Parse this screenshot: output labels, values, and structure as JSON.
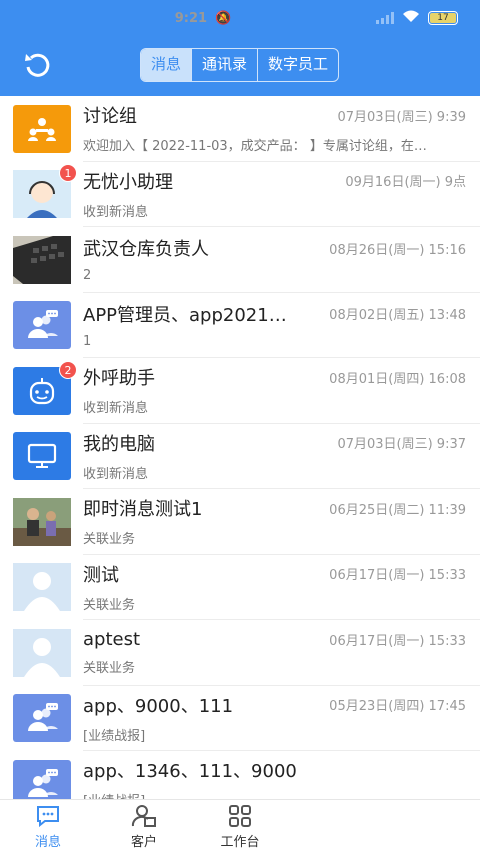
{
  "status": {
    "time": "9:21",
    "battery": "17"
  },
  "header": {
    "tabs": [
      {
        "label": "消息",
        "active": true
      },
      {
        "label": "通讯录",
        "active": false
      },
      {
        "label": "数字员工",
        "active": false
      }
    ]
  },
  "conversations": [
    {
      "name": "讨论组",
      "time": "07月03日(周三) 9:39",
      "msg": "欢迎加入【 2022-11-03，成交产品：  】专属讨论组，在…",
      "avatar": "group-chat-icon",
      "color": "#f59a0b"
    },
    {
      "name": "无忧小助理",
      "time": "09月16日(周一) 9点",
      "msg": "收到新消息",
      "avatar": "assistant-avatar",
      "badge": "1"
    },
    {
      "name": "武汉仓库负责人",
      "time": "08月26日(周一) 15:16",
      "msg": "2",
      "avatar": "keyboard-photo"
    },
    {
      "name": "APP管理员、app2021…",
      "time": "08月02日(周五) 13:48",
      "msg": "1",
      "avatar": "group-icon",
      "color": "#6c8fe6"
    },
    {
      "name": "外呼助手",
      "time": "08月01日(周四) 16:08",
      "msg": "收到新消息",
      "avatar": "robot-icon",
      "color": "#2d7be5",
      "badge": "2"
    },
    {
      "name": "我的电脑",
      "time": "07月03日(周三) 9:37",
      "msg": "收到新消息",
      "avatar": "monitor-icon",
      "color": "#2d7be5"
    },
    {
      "name": "即时消息测试1",
      "time": "06月25日(周二) 11:39",
      "msg": "关联业务",
      "avatar": "people-photo"
    },
    {
      "name": "测试",
      "time": "06月17日(周一) 15:33",
      "msg": "关联业务",
      "avatar": "default-user-avatar"
    },
    {
      "name": "aptest",
      "time": "06月17日(周一) 15:33",
      "msg": "关联业务",
      "avatar": "default-user-avatar"
    },
    {
      "name": "app、9000、111",
      "time": "05月23日(周四) 17:45",
      "msg": "[业绩战报]",
      "avatar": "group-icon",
      "color": "#6c8fe6"
    },
    {
      "name": "app、1346、111、9000",
      "time": "",
      "msg": "[业绩战报]",
      "avatar": "group-icon",
      "color": "#6c8fe6"
    }
  ],
  "bottom_nav": [
    {
      "label": "消息",
      "icon": "chat-icon",
      "active": true
    },
    {
      "label": "客户",
      "icon": "customer-icon",
      "active": false
    },
    {
      "label": "工作台",
      "icon": "grid-icon",
      "active": false
    }
  ]
}
